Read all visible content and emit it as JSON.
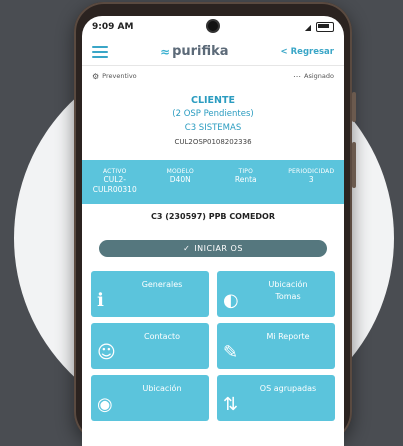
{
  "status": {
    "time": "9:09 AM",
    "signal": "◢",
    "battery": ""
  },
  "header": {
    "logo": "purifika",
    "back": "Regresar"
  },
  "tags": {
    "left": "Preventivo",
    "right": "Asignado"
  },
  "client": {
    "title": "CLIENTE",
    "pending": "(2 OSP Pendientes)",
    "name": "C3 SISTEMAS",
    "code": "CUL2OSP0108202336"
  },
  "info": [
    {
      "label": "ACTIVO",
      "value": "CUL2-\nCULR00310"
    },
    {
      "label": "MODELO",
      "value": "D40N"
    },
    {
      "label": "TIPO",
      "value": "Renta"
    },
    {
      "label": "PERIODICIDAD",
      "value": "3"
    }
  ],
  "site": "C3 (230597)  PPB COMEDOR",
  "start_button": "INICIAR OS",
  "tiles": [
    {
      "label": "Generales",
      "icon": "ℹ"
    },
    {
      "label": "Ubicación\nTomas",
      "icon": "◐"
    },
    {
      "label": "Contacto",
      "icon": "☺"
    },
    {
      "label": "Mi Reporte",
      "icon": "✎"
    },
    {
      "label": "Ubicación",
      "icon": "◉"
    },
    {
      "label": "OS agrupadas",
      "icon": "⇅"
    }
  ]
}
